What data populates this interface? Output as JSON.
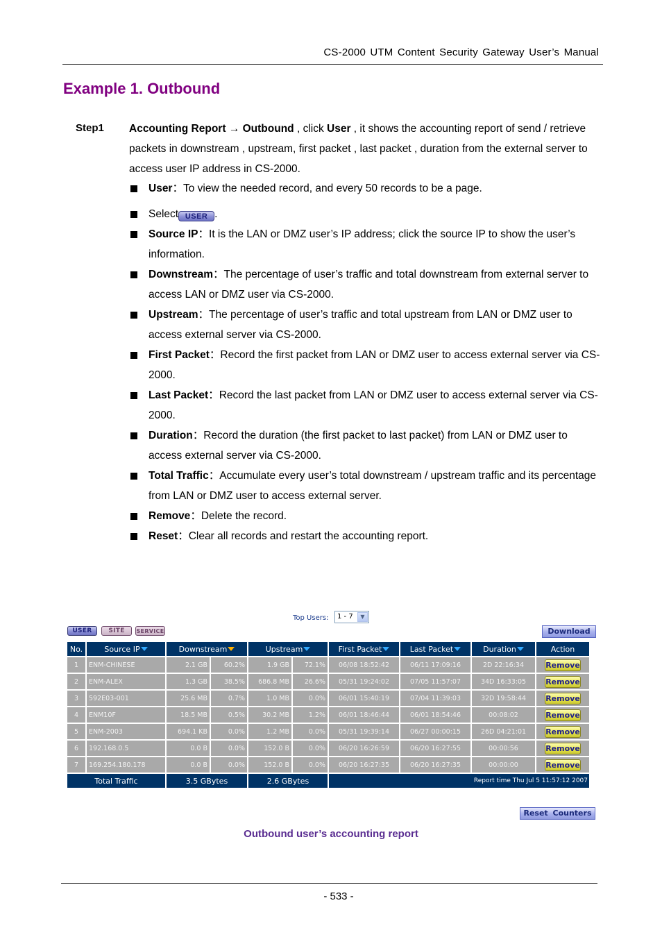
{
  "header": {
    "title": "CS-2000  UTM  Content  Security  Gateway  User’s  Manual"
  },
  "section_title": "Example 1. Outbound",
  "step": {
    "label": "Step1",
    "path_a": "Accounting Report",
    "arrow": "→",
    "path_b": "Outbound",
    "mid1": " , click ",
    "click_target": "User",
    "rest": " , it shows the accounting report of send / retrieve packets in downstream , upstream, first packet , last packet , duration from the external server to access user IP address in CS-2000."
  },
  "bullets": [
    {
      "term": "User",
      "text": "To view the needed record, and every 50 records to be a page."
    },
    {
      "term": "",
      "text": "Select",
      "button": "USER",
      "after": "."
    },
    {
      "term": "Source IP",
      "text": "It is the LAN or DMZ user’s IP address; click the source IP to show the user’s information."
    },
    {
      "term": "Downstream",
      "text": "The percentage of user’s traffic and total downstream from external server to access LAN or DMZ user via CS-2000."
    },
    {
      "term": "Upstream",
      "text": "The percentage of user’s traffic and total upstream from LAN or DMZ user to access external server via CS-2000."
    },
    {
      "term": "First Packet",
      "text": "Record the first packet from LAN or DMZ user to access external server via CS-2000."
    },
    {
      "term": "Last Packet",
      "text": "Record the last packet from LAN or DMZ user to access external server via CS-2000."
    },
    {
      "term": "Duration",
      "text": "Record the duration (the first packet to last packet) from LAN or DMZ user to access external server via CS-2000."
    },
    {
      "term": "Total Traffic",
      "text": "Accumulate every user’s total downstream / upstream traffic and its percentage from LAN or DMZ user to access external server."
    },
    {
      "term": "Remove",
      "text": "Delete the record."
    },
    {
      "term": "Reset",
      "text": "Clear all records and restart the accounting report."
    }
  ],
  "ui": {
    "top_users_label": "Top Users:",
    "top_users_value": "1 - 7",
    "tabs": [
      "USER",
      "SITE",
      "SERVICE"
    ],
    "download_label": "Download",
    "columns": [
      "No.",
      "Source IP",
      "Downstream",
      "Upstream",
      "First Packet",
      "Last Packet",
      "Duration",
      "Action"
    ],
    "rows": [
      {
        "no": "1",
        "ip": "ENM-CHINESE",
        "down": "2.1 GB",
        "down_pct": "60.2%",
        "up": "1.9 GB",
        "up_pct": "72.1%",
        "first": "06/08 18:52:42",
        "last": "06/11 17:09:16",
        "duration": "2D 22:16:34",
        "action": "Remove"
      },
      {
        "no": "2",
        "ip": "ENM-ALEX",
        "down": "1.3 GB",
        "down_pct": "38.5%",
        "up": "686.8 MB",
        "up_pct": "26.6%",
        "first": "05/31 19:24:02",
        "last": "07/05 11:57:07",
        "duration": "34D 16:33:05",
        "action": "Remove"
      },
      {
        "no": "3",
        "ip": "592E03-001",
        "down": "25.6 MB",
        "down_pct": "0.7%",
        "up": "1.0 MB",
        "up_pct": "0.0%",
        "first": "06/01 15:40:19",
        "last": "07/04 11:39:03",
        "duration": "32D 19:58:44",
        "action": "Remove"
      },
      {
        "no": "4",
        "ip": "ENM10F",
        "down": "18.5 MB",
        "down_pct": "0.5%",
        "up": "30.2 MB",
        "up_pct": "1.2%",
        "first": "06/01 18:46:44",
        "last": "06/01 18:54:46",
        "duration": "00:08:02",
        "action": "Remove"
      },
      {
        "no": "5",
        "ip": "ENM-2003",
        "down": "694.1 KB",
        "down_pct": "0.0%",
        "up": "1.2 MB",
        "up_pct": "0.0%",
        "first": "05/31 19:39:14",
        "last": "06/27 00:00:15",
        "duration": "26D 04:21:01",
        "action": "Remove"
      },
      {
        "no": "6",
        "ip": "192.168.0.5",
        "down": "0.0 B",
        "down_pct": "0.0%",
        "up": "152.0 B",
        "up_pct": "0.0%",
        "first": "06/20 16:26:59",
        "last": "06/20 16:27:55",
        "duration": "00:00:56",
        "action": "Remove"
      },
      {
        "no": "7",
        "ip": "169.254.180.178",
        "down": "0.0 B",
        "down_pct": "0.0%",
        "up": "152.0 B",
        "up_pct": "0.0%",
        "first": "06/20 16:27:35",
        "last": "06/20 16:27:35",
        "duration": "00:00:00",
        "action": "Remove"
      }
    ],
    "total": {
      "label": "Total Traffic",
      "down": "3.5 GBytes",
      "up": "2.6 GBytes",
      "report_time": "Report time Thu Jul 5 11:57:12 2007"
    },
    "reset_label": "Reset  Counters",
    "colors": {
      "header_bg": "#003366",
      "cell_bg": "#a9a9a9",
      "sort_active": "#ffb000",
      "sort_inactive": "#33aaff"
    }
  },
  "caption": "Outbound user’s accounting report",
  "page_number": "- 533 -"
}
